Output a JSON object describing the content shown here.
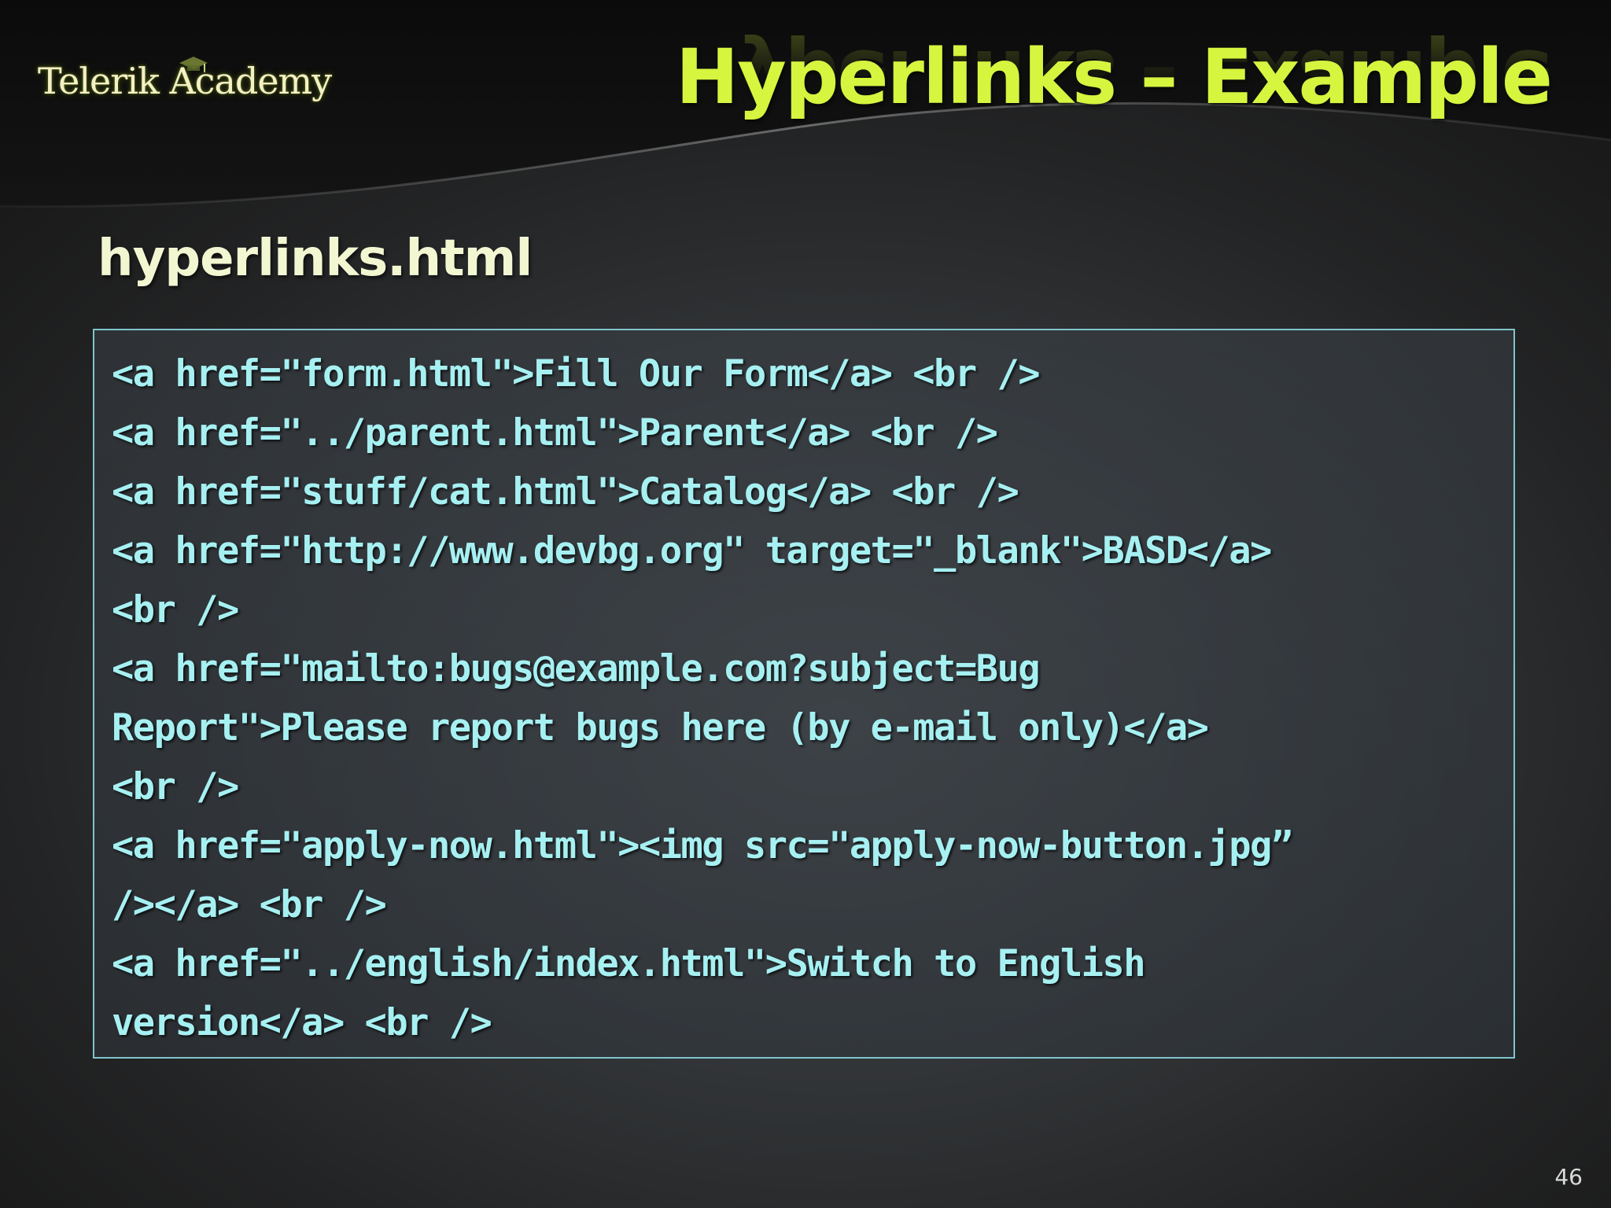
{
  "header": {
    "logo_text": "Telerik Academy",
    "title": "Hyperlinks – Example"
  },
  "content": {
    "filename": "hyperlinks.html",
    "code_lines": [
      "<a href=\"form.html\">Fill Our Form</a> <br />",
      "<a href=\"../parent.html\">Parent</a> <br />",
      "<a href=\"stuff/cat.html\">Catalog</a> <br />",
      "<a href=\"http://www.devbg.org\" target=\"_blank\">BASD</a>",
      "<br />",
      "<a href=\"mailto:bugs@example.com?subject=Bug",
      "Report\">Please report bugs here (by e-mail only)</a>",
      "<br />",
      "<a href=\"apply-now.html\"><img src=\"apply-now-button.jpg”",
      "/></a> <br />",
      "<a href=\"../english/index.html\">Switch to English",
      "version</a> <br />"
    ]
  },
  "footer": {
    "page_number": "46"
  },
  "colors": {
    "title": "#d5f53f",
    "code_text": "#a6f0f2",
    "code_border": "#7fc4cc",
    "filename": "#f2f7d2"
  }
}
